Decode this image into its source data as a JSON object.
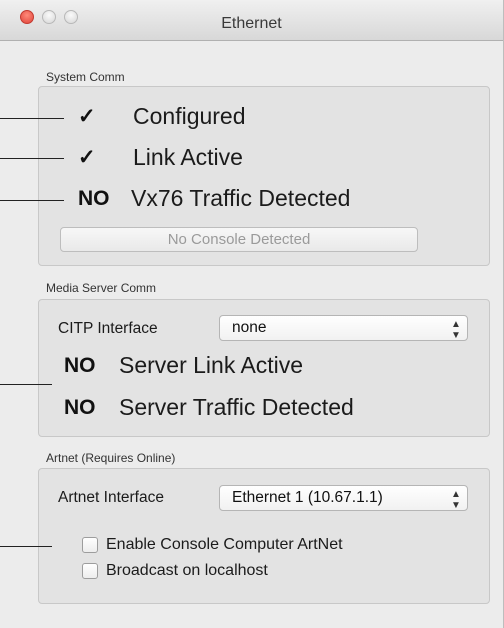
{
  "window": {
    "title": "Ethernet"
  },
  "system_comm": {
    "label": "System Comm",
    "rows": [
      {
        "mark": "✓",
        "text": "Configured"
      },
      {
        "mark": "✓",
        "text": "Link Active"
      },
      {
        "mark": "NO",
        "text": "Vx76 Traffic Detected"
      }
    ],
    "console_button": "No Console Detected"
  },
  "media_server_comm": {
    "label": "Media Server Comm",
    "citp_label": "CITP Interface",
    "citp_value": "none",
    "rows": [
      {
        "mark": "NO",
        "text": "Server Link Active"
      },
      {
        "mark": "NO",
        "text": "Server Traffic Detected"
      }
    ]
  },
  "artnet": {
    "label": "Artnet (Requires Online)",
    "interface_label": "Artnet Interface",
    "interface_value": "Ethernet 1 (10.67.1.1)",
    "checkboxes": [
      {
        "label": "Enable Console Computer ArtNet",
        "checked": false
      },
      {
        "label": "Broadcast on localhost",
        "checked": false
      }
    ]
  },
  "icons": {
    "select_arrows": "up-down-chevron-icon"
  }
}
